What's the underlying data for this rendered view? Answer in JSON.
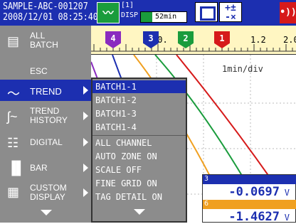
{
  "header": {
    "batch_name": "SAMPLE-ABC-001207",
    "datetime": "2008/12/01 08:25:40",
    "group_number": "[1]",
    "disp_label": "DISP",
    "interval_label": "52min",
    "interval_progress": 0.25,
    "math_icon_text": "+±\n-×",
    "alarm_icon_text": "•))"
  },
  "scale": {
    "values": [
      "-0.",
      "1.2",
      "2.0"
    ],
    "markers": [
      {
        "label": "4",
        "color": "#8a2bbf"
      },
      {
        "label": "3",
        "color": "#1c2fb0"
      },
      {
        "label": "2",
        "color": "#1a9c3c"
      },
      {
        "label": "1",
        "color": "#d61a1a"
      }
    ]
  },
  "trend": {
    "time_div": "1min/div"
  },
  "left_menu": {
    "all_batch": [
      "ALL",
      "BATCH"
    ],
    "esc": "ESC",
    "trend": "TREND",
    "trend_history": [
      "TREND",
      "HISTORY"
    ],
    "digital": "DIGITAL",
    "bar": "BAR",
    "custom_display": [
      "CUSTOM",
      "DISPLAY"
    ]
  },
  "submenu": {
    "items": [
      "BATCH1-1",
      "BATCH1-2",
      "BATCH1-3",
      "BATCH1-4",
      "ALL CHANNEL",
      "AUTO ZONE ON",
      "SCALE OFF",
      "FINE GRID ON",
      "TAG DETAIL ON"
    ]
  },
  "readouts": [
    {
      "channel": "3",
      "value": "-0.0697",
      "unit": "V",
      "color": "#1c2fb0"
    },
    {
      "channel": "6",
      "value": "-1.4627",
      "unit": "V",
      "color": "#f0a020"
    }
  ]
}
